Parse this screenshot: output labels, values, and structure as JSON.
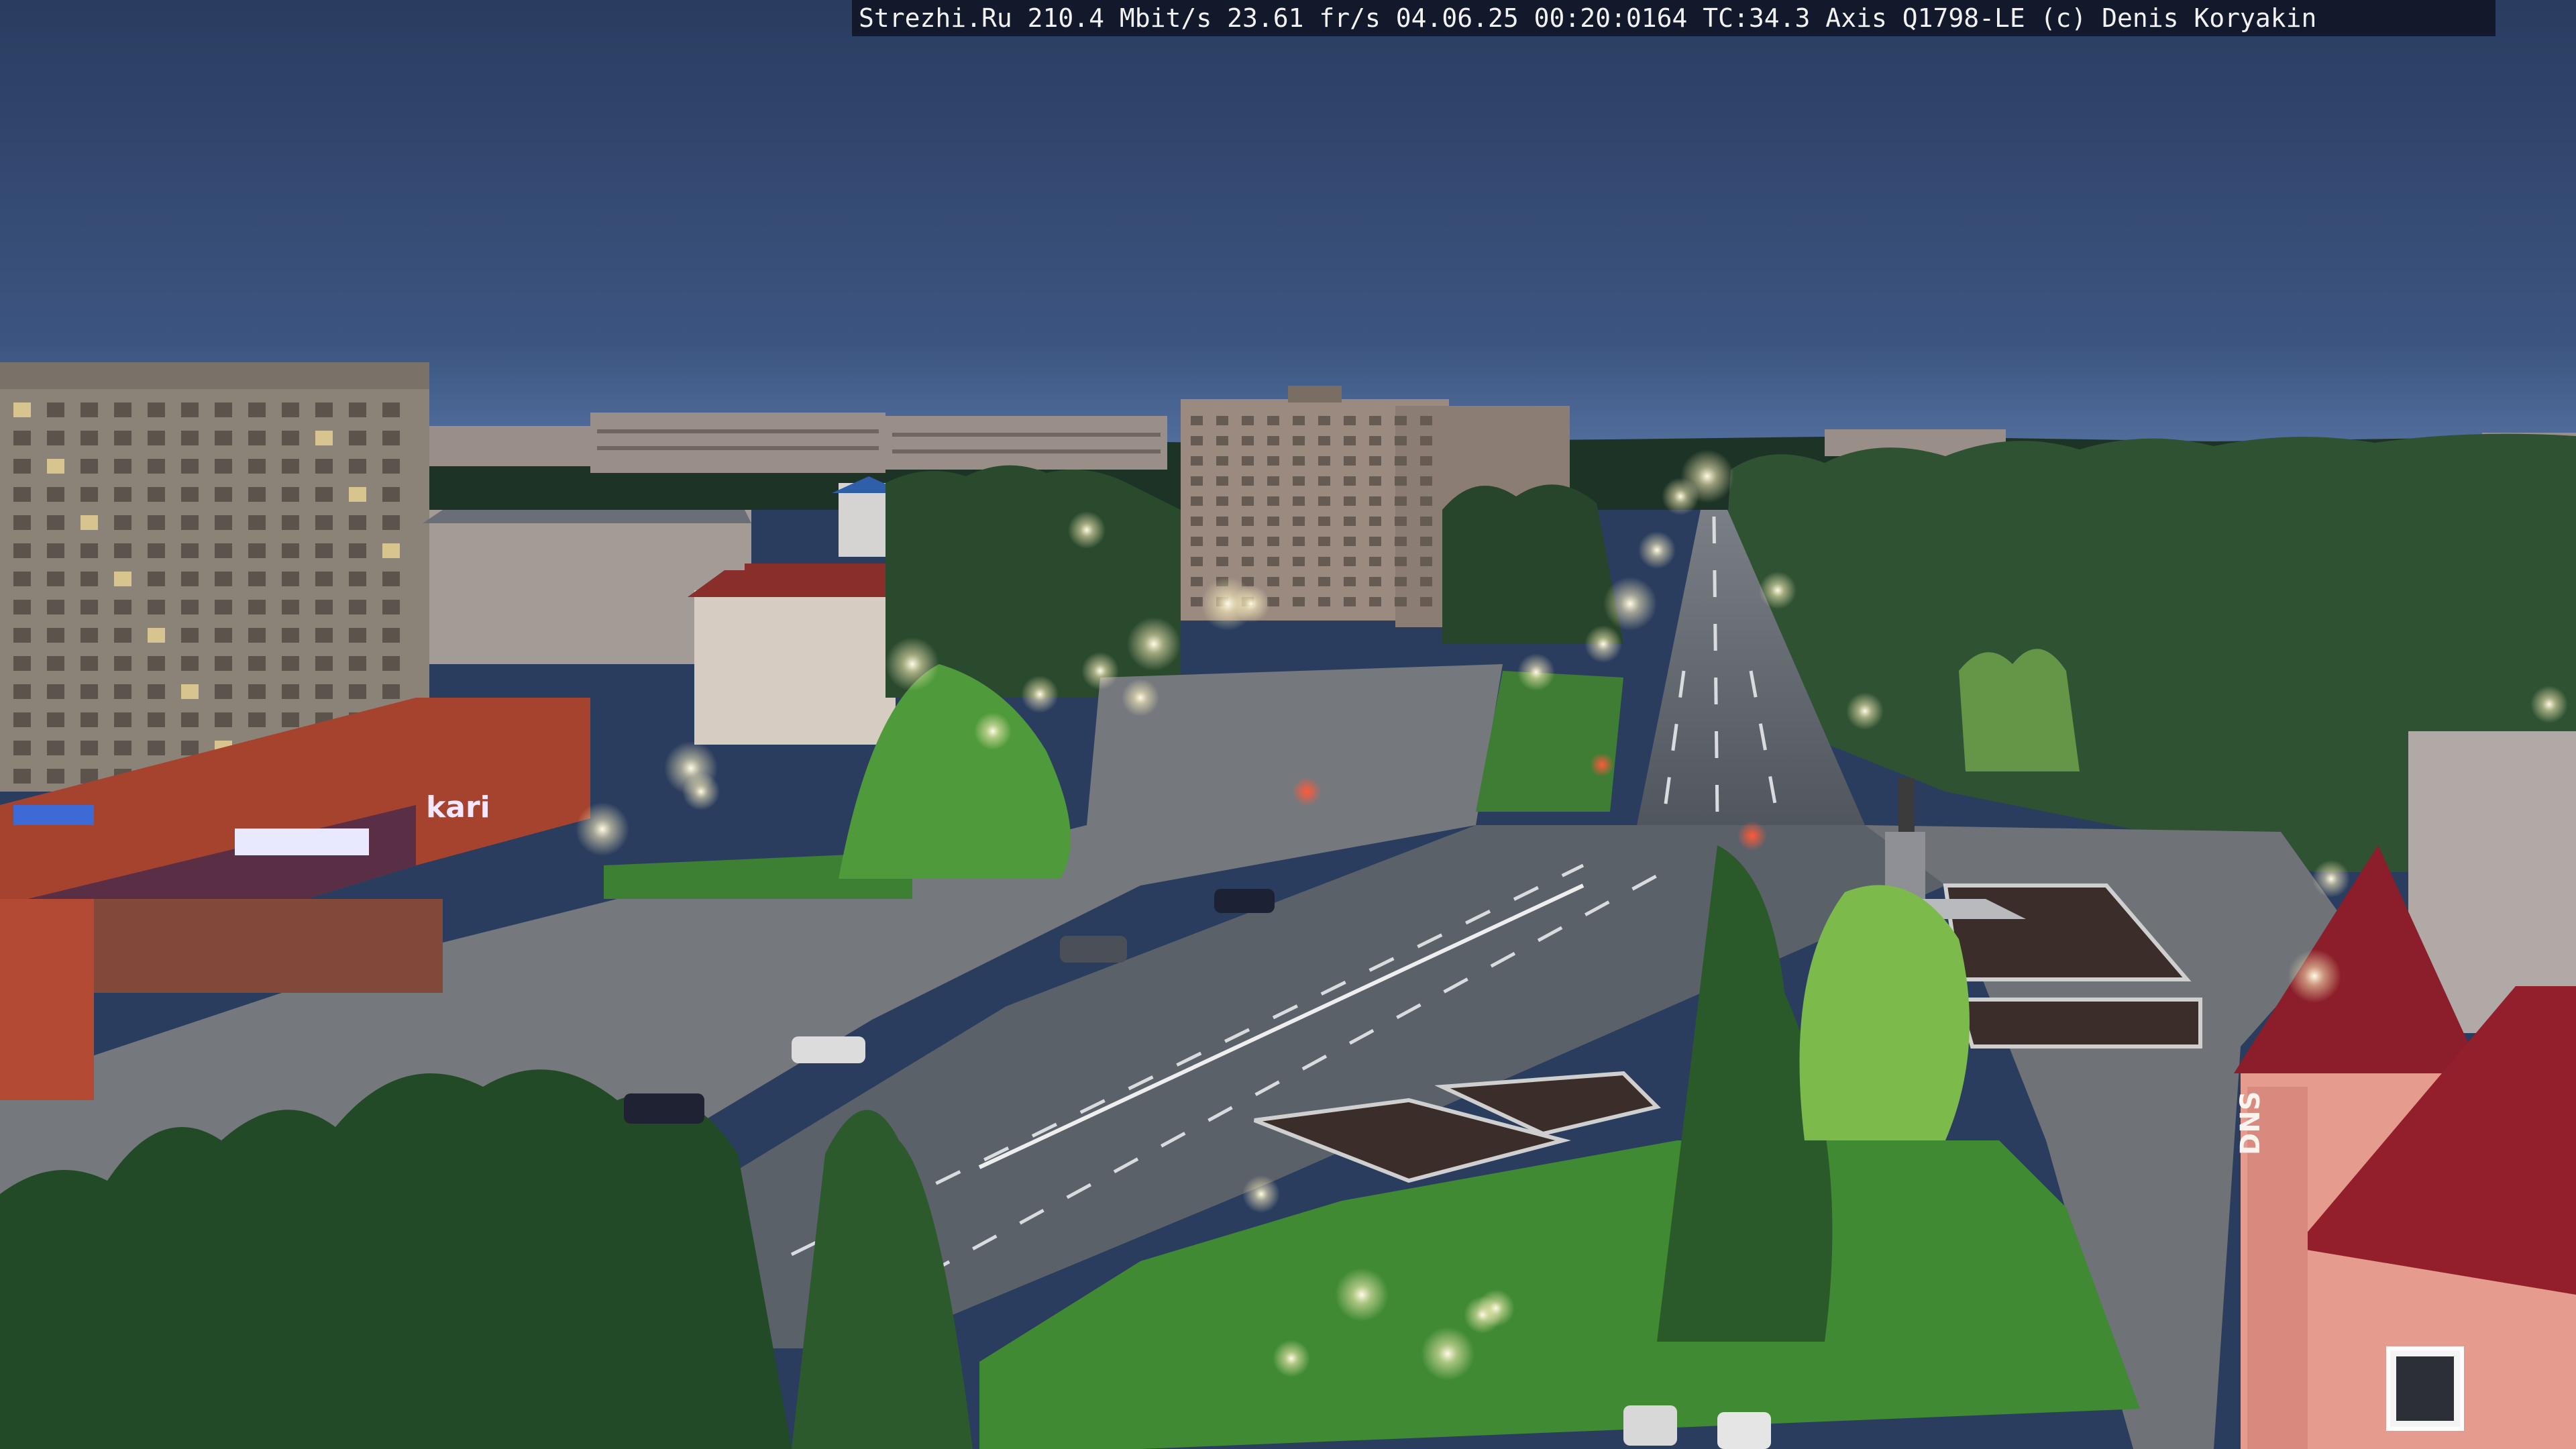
{
  "overlay": {
    "text": "Strezhi.Ru 210.4 Mbit/s 23.61 fr/s 04.06.25 00:20:0164 TC:34.3  Axis Q1798-LE  (c) Denis Koryakin"
  },
  "signs": {
    "store_left": "kari",
    "store_right": "DNS"
  },
  "colors": {
    "sky_top": "#2f4366",
    "sky_horizon": "#4f6a96",
    "grass": "#3f8a32",
    "asphalt": "#5b6168",
    "street_light": "#fff6d8"
  }
}
